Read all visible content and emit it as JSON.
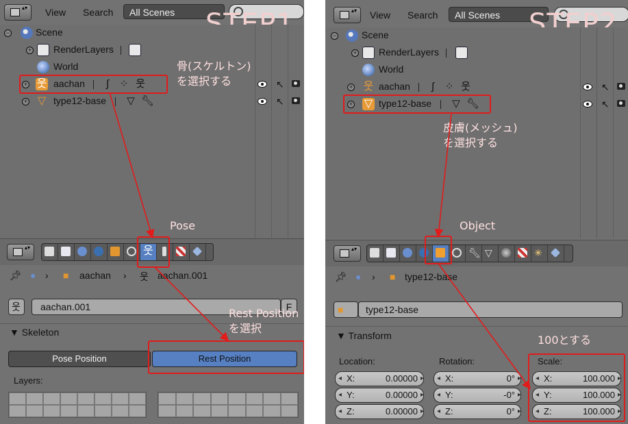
{
  "step1": {
    "menu_view": "View",
    "menu_search": "Search",
    "scenes_select": "All Scenes",
    "step_label": "STEP1",
    "tree": {
      "scene": "Scene",
      "renderlayers": "RenderLayers",
      "world": "World",
      "armature": "aachan",
      "mesh": "type12-base"
    },
    "breadcrumb_object": "aachan",
    "breadcrumb_data": "aachan.001",
    "datablock_name": "aachan.001",
    "datablock_f": "F",
    "section_title": "Skeleton",
    "pose_position": "Pose Position",
    "rest_position": "Rest Position",
    "layers_label": "Layers:",
    "note_select_bone": "骨(スケルトン)\nを選択する",
    "note_pose": "Pose",
    "note_rest": "Rest Position\nを選択"
  },
  "step2": {
    "menu_view": "View",
    "menu_search": "Search",
    "scenes_select": "All Scenes",
    "step_label": "STEP2",
    "tree": {
      "scene": "Scene",
      "renderlayers": "RenderLayers",
      "world": "World",
      "armature": "aachan",
      "mesh": "type12-base"
    },
    "breadcrumb_object": "type12-base",
    "datablock_name": "type12-base",
    "section_title": "Transform",
    "location_label": "Location:",
    "rotation_label": "Rotation:",
    "scale_label": "Scale:",
    "location": [
      {
        "axis": "X:",
        "value": "0.00000"
      },
      {
        "axis": "Y:",
        "value": "0.00000"
      },
      {
        "axis": "Z:",
        "value": "0.00000"
      }
    ],
    "rotation": [
      {
        "axis": "X:",
        "value": "0°"
      },
      {
        "axis": "Y:",
        "value": "-0°"
      },
      {
        "axis": "Z:",
        "value": "0°"
      }
    ],
    "scale": [
      {
        "axis": "X:",
        "value": "100.000"
      },
      {
        "axis": "Y:",
        "value": "100.000"
      },
      {
        "axis": "Z:",
        "value": "100.000"
      }
    ],
    "note_select_skin": "皮膚(メッシュ)\nを選択する",
    "note_object": "Object",
    "note_scale": "100とする"
  },
  "colors": {
    "annotation_red": "#e21b1b",
    "active_blue": "#5680c2",
    "annotation_text": "#ffe0e0"
  }
}
